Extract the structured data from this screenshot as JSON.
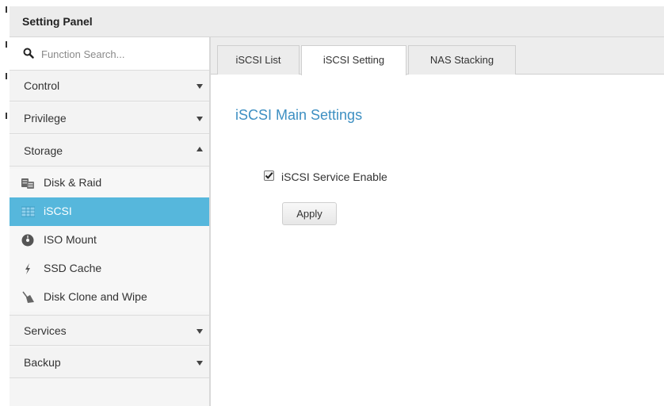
{
  "header": {
    "title": "Setting Panel"
  },
  "search": {
    "placeholder": "Function Search...",
    "icon": "search-icon"
  },
  "sidebar": {
    "categories": [
      {
        "label": "Control",
        "expanded": false
      },
      {
        "label": "Privilege",
        "expanded": false
      },
      {
        "label": "Storage",
        "expanded": true
      },
      {
        "label": "Services",
        "expanded": false
      },
      {
        "label": "Backup",
        "expanded": false
      }
    ],
    "storage_items": [
      {
        "label": "Disk & Raid",
        "icon": "disk-icon",
        "active": false
      },
      {
        "label": "iSCSI",
        "icon": "iscsi-icon",
        "active": true
      },
      {
        "label": "ISO Mount",
        "icon": "iso-mount-icon",
        "active": false
      },
      {
        "label": "SSD Cache",
        "icon": "lightning-icon",
        "active": false
      },
      {
        "label": "Disk Clone and Wipe",
        "icon": "broom-icon",
        "active": false
      }
    ]
  },
  "tabs": [
    {
      "label": "iSCSI List",
      "active": false
    },
    {
      "label": "iSCSI Setting",
      "active": true
    },
    {
      "label": "NAS Stacking",
      "active": false
    }
  ],
  "main": {
    "section_title": "iSCSI Main Settings",
    "service_enable_label": "iSCSI Service Enable",
    "service_enabled": true,
    "apply_label": "Apply"
  },
  "colors": {
    "active_item": "#56b7dc",
    "section_title": "#3d8fc2"
  }
}
